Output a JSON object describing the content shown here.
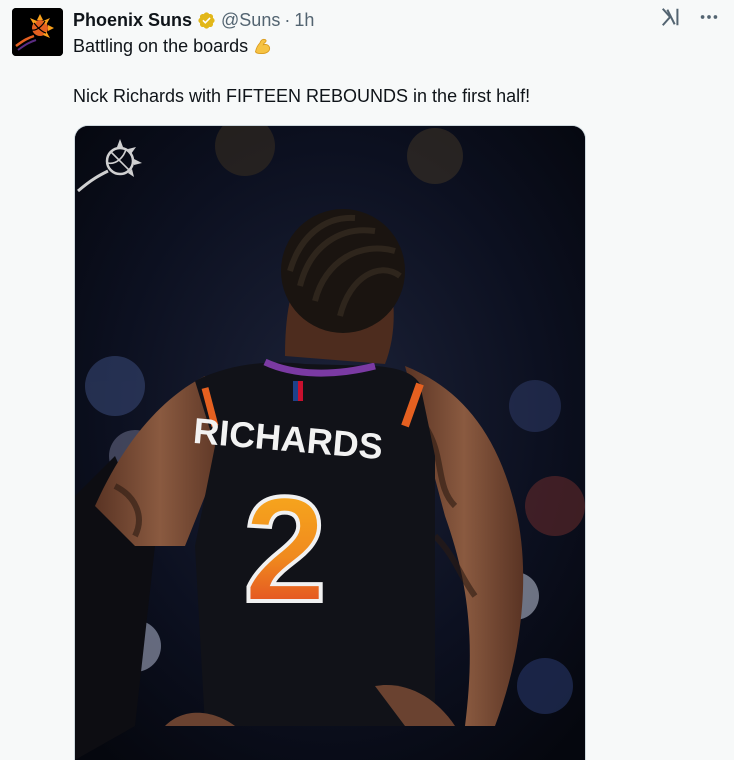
{
  "tweet": {
    "author_name": "Phoenix Suns",
    "handle": "@Suns",
    "separator": "·",
    "time": "1h",
    "line1": "Battling on the boards",
    "line2": "Nick Richards with FIFTEEN REBOUNDS in the first half!"
  },
  "icons": {
    "avatar": "suns-logo",
    "verified": "verified-badge-icon",
    "grok": "grok-icon",
    "more": "more-options-icon",
    "emoji": "flexed-biceps-emoji"
  },
  "photo": {
    "jersey_name": "RICHARDS",
    "jersey_number": "2"
  },
  "colors": {
    "verified_gold": "#e2b719",
    "suns_orange": "#e56020",
    "suns_purple": "#5b2c83"
  }
}
